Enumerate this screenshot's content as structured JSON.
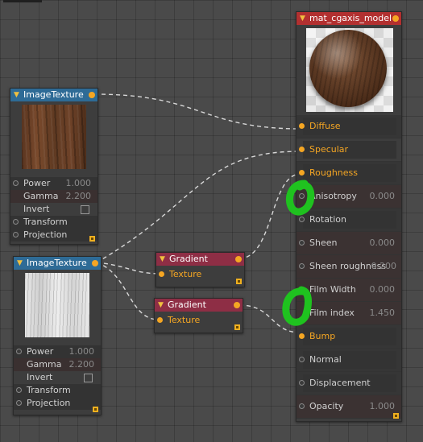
{
  "colors": {
    "accent": "#f5a623",
    "node_blue": "#2e6b96",
    "node_red": "#8e2e45",
    "material_red": "#b23030",
    "annotation_green": "#1fc21f"
  },
  "image_texture_1": {
    "title": "ImageTexture",
    "params": [
      {
        "label": "Power",
        "value": "1.000"
      },
      {
        "label": "Gamma",
        "value": "2.200"
      },
      {
        "label": "Invert"
      },
      {
        "label": "Transform"
      },
      {
        "label": "Projection"
      }
    ]
  },
  "image_texture_2": {
    "title": "ImageTexture",
    "params": [
      {
        "label": "Power",
        "value": "1.000"
      },
      {
        "label": "Gamma",
        "value": "2.200"
      },
      {
        "label": "Invert"
      },
      {
        "label": "Transform"
      },
      {
        "label": "Projection"
      }
    ]
  },
  "gradient_1": {
    "title": "Gradient",
    "input": "Texture"
  },
  "gradient_2": {
    "title": "Gradient",
    "input": "Texture"
  },
  "material": {
    "title": "mat_cgaxis_model",
    "inputs": [
      {
        "label": "Diffuse",
        "value": ""
      },
      {
        "label": "Specular",
        "value": ""
      },
      {
        "label": "Roughness",
        "value": ""
      },
      {
        "label": "Anisotropy",
        "value": "0.000"
      },
      {
        "label": "Rotation",
        "value": ""
      },
      {
        "label": "Sheen",
        "value": "0.000"
      },
      {
        "label": "Sheen roughness",
        "value": "0.200"
      },
      {
        "label": "Film Width",
        "value": "0.000"
      },
      {
        "label": "Film index",
        "value": "1.450"
      },
      {
        "label": "Bump",
        "value": ""
      },
      {
        "label": "Normal",
        "value": ""
      },
      {
        "label": "Displacement",
        "value": ""
      },
      {
        "label": "Opacity",
        "value": "1.000"
      }
    ]
  }
}
